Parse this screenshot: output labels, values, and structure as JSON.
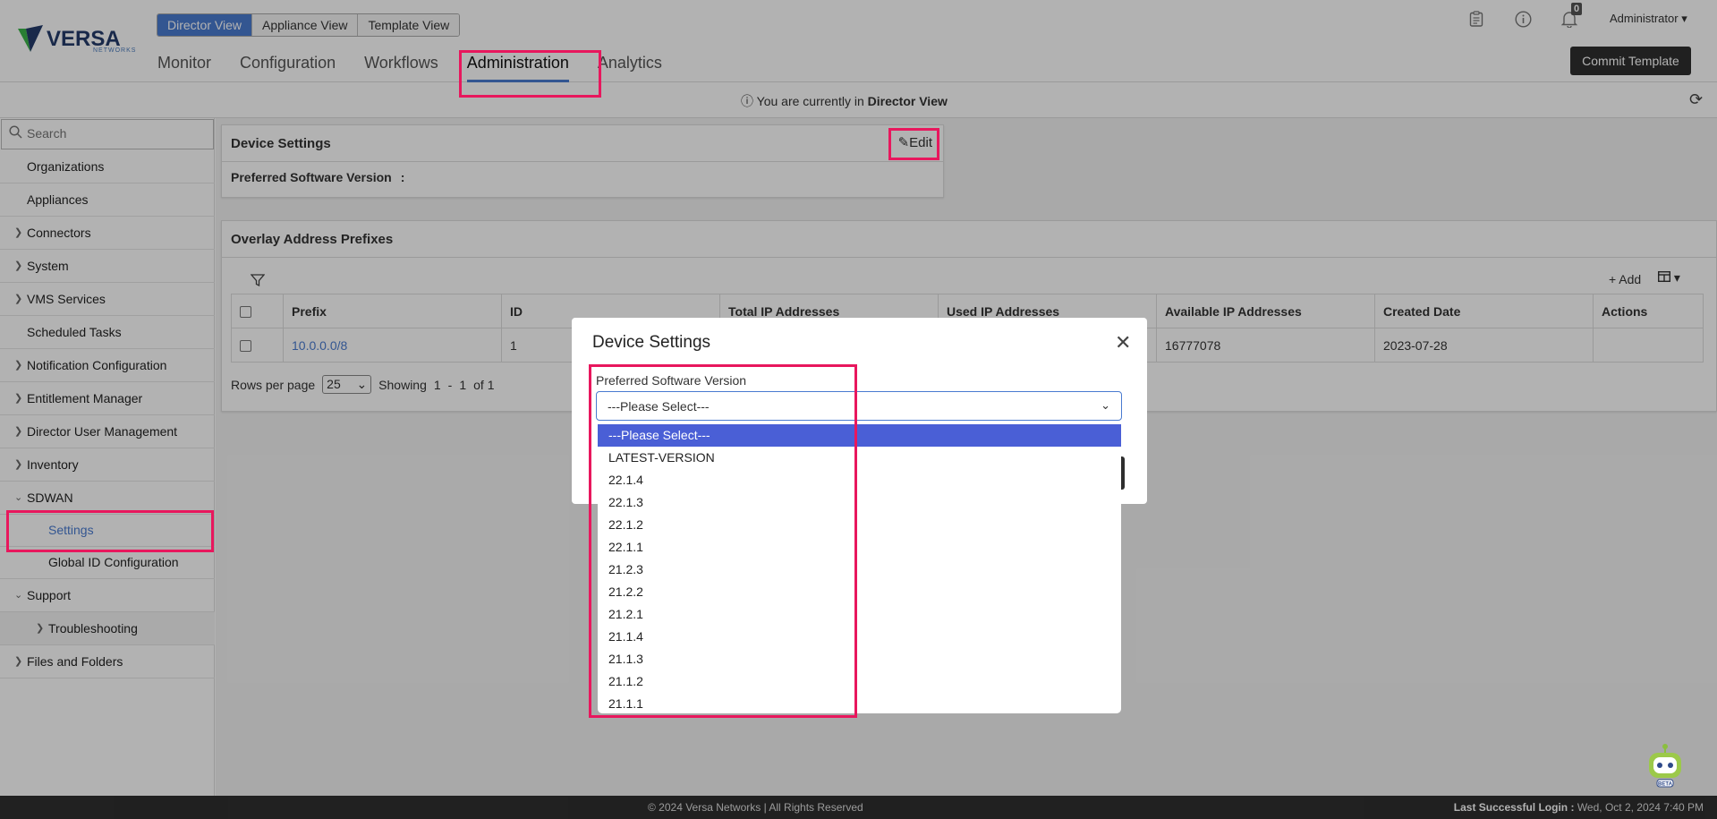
{
  "brand": {
    "name": "VERSA",
    "sub": "NETWORKS"
  },
  "view_switch": [
    "Director View",
    "Appliance View",
    "Template View"
  ],
  "nav_tabs": [
    "Monitor",
    "Configuration",
    "Workflows",
    "Administration",
    "Analytics"
  ],
  "header": {
    "user": "Administrator",
    "notification_count": "0",
    "commit_label": "Commit Template"
  },
  "infobar": {
    "prefix": "You are currently in",
    "view": "Director View"
  },
  "sidebar": {
    "search_placeholder": "Search",
    "items": [
      "Organizations",
      "Appliances",
      "Connectors",
      "System",
      "VMS Services",
      "Scheduled Tasks",
      "Notification Configuration",
      "Entitlement Manager",
      "Director User Management",
      "Inventory",
      "SDWAN",
      "Settings",
      "Global ID Configuration",
      "Support",
      "Troubleshooting",
      "Files and Folders"
    ]
  },
  "device_settings": {
    "title": "Device Settings",
    "edit_label": "Edit",
    "pref_label": "Preferred Software Version",
    "pref_colon": ":"
  },
  "overlay_card": {
    "title": "Overlay Address Prefixes",
    "add_label": "+ Add",
    "columns": [
      "Prefix",
      "ID",
      "Total IP Addresses",
      "Used IP Addresses",
      "Available IP Addresses",
      "Created Date",
      "Actions"
    ],
    "rows": [
      {
        "prefix": "10.0.0.0/8",
        "id": "1",
        "total": "",
        "used": "",
        "available": "16777078",
        "created": "2023-07-28"
      }
    ],
    "pager": {
      "label": "Rows per page",
      "size": "25",
      "showing": "Showing",
      "from": "1",
      "dash": "-",
      "to": "1",
      "of": "of 1"
    }
  },
  "modal": {
    "title": "Device Settings",
    "field_label": "Preferred Software Version",
    "selected": "---Please Select---",
    "options": [
      "---Please Select---",
      "LATEST-VERSION",
      "22.1.4",
      "22.1.3",
      "22.1.2",
      "22.1.1",
      "21.2.3",
      "21.2.2",
      "21.2.1",
      "21.1.4",
      "21.1.3",
      "21.1.2",
      "21.1.1"
    ]
  },
  "footer": {
    "copyright": "© 2024 Versa Networks | All Rights Reserved",
    "login_label": "Last Successful Login :",
    "login_value": "Wed, Oct 2, 2024 7:40 PM"
  },
  "colors": {
    "accent": "#4a7bd0",
    "highlight": "#e8175d",
    "dark": "#2e2e2e"
  }
}
